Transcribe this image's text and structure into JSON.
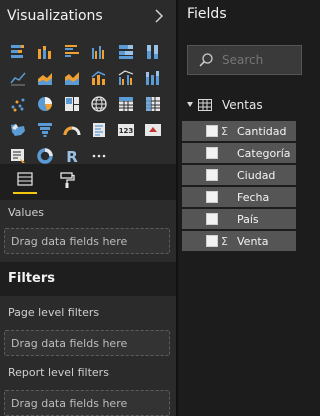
{
  "visualizations": {
    "title": "Visualizations",
    "values_label": "Values",
    "values_placeholder": "Drag data fields here",
    "icons": [
      [
        "stacked-bar-icon",
        "stacked-column-icon",
        "clustered-bar-icon",
        "clustered-column-icon",
        "100-bar-icon",
        "100-column-icon"
      ],
      [
        "line-chart-icon",
        "area-chart-icon",
        "stacked-area-icon",
        "line-column-icon",
        "line-clustered-column-icon",
        "ribbon-chart-icon"
      ],
      [
        "scatter-icon",
        "pie-icon",
        "treemap-icon",
        "globe-map-icon",
        "table-icon",
        "matrix-icon"
      ],
      [
        "filled-map-icon",
        "funnel-icon",
        "gauge-icon",
        "multi-row-card-icon",
        "card-icon",
        "kpi-icon"
      ],
      [
        "slicer-icon",
        "donut-icon",
        "r-visual-icon",
        "more-icon"
      ]
    ]
  },
  "filters": {
    "title": "Filters",
    "page_level": "Page level filters",
    "page_placeholder": "Drag data fields here",
    "report_level": "Report level filters",
    "report_placeholder": "Drag data fields here"
  },
  "fields": {
    "title": "Fields",
    "search_placeholder": "Search",
    "table": "Ventas",
    "items": [
      {
        "label": "Cantidad",
        "sigma": "Σ"
      },
      {
        "label": "Categoría",
        "sigma": ""
      },
      {
        "label": "Ciudad",
        "sigma": ""
      },
      {
        "label": "Fecha",
        "sigma": ""
      },
      {
        "label": "País",
        "sigma": ""
      },
      {
        "label": "Venta",
        "sigma": "Σ"
      }
    ]
  },
  "colors": {
    "accent": "#f2c811",
    "bar_blue": "#5b9bd5",
    "bar_orange": "#f0a030",
    "pane": "#2b2b2b"
  }
}
